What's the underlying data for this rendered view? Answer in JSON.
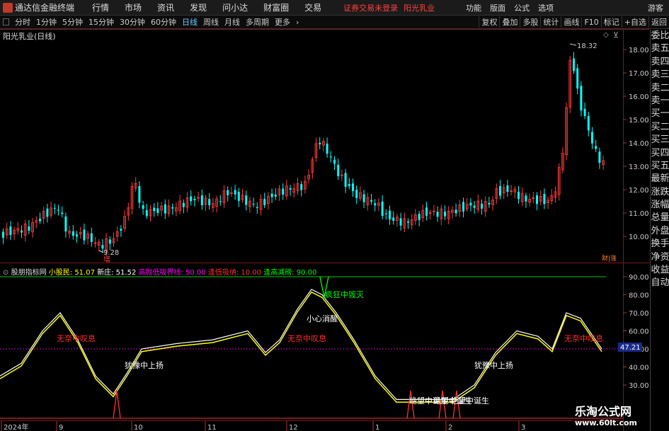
{
  "menubar": {
    "app_title": "通达信金融终端",
    "items": [
      "行情",
      "市场",
      "资讯",
      "发现",
      "问小达",
      "财富圈",
      "交易"
    ],
    "warning": "证券交易未登录",
    "stock": "阳光乳业",
    "right_items": [
      "功能",
      "版面",
      "公式",
      "选项"
    ],
    "guest": "游客"
  },
  "toolbar": {
    "periods": [
      "分时",
      "1分钟",
      "5分钟",
      "15分钟",
      "30分钟",
      "60分钟",
      "日线",
      "周线",
      "月线",
      "多周期",
      "更多"
    ],
    "active_period": "日线",
    "right_buttons": [
      "复权",
      "叠加",
      "多股",
      "统计",
      "画线",
      "F10",
      "标记",
      "+自选",
      "返回"
    ]
  },
  "chart": {
    "title": "阳光乳业(日线)",
    "price_labels": [
      "18.00",
      "17.00",
      "16.00",
      "15.00",
      "14.00",
      "13.00",
      "12.00",
      "11.00",
      "10.00"
    ],
    "high_label": "18.32",
    "low_label": "9.28",
    "low_tag": "增",
    "corner_tag": "财|涨",
    "up_color": "#ff3b3b",
    "down_color": "#00ffff"
  },
  "indicator": {
    "name": "股朋指标网",
    "values": [
      {
        "label": "小股民: 51.07",
        "color": "#ffff00"
      },
      {
        "label": "新庄: 51.52",
        "color": "#ffffff"
      },
      {
        "label": "高抛低吸界线: 50.00",
        "color": "#ff00ff"
      },
      {
        "label": "逢低吸纳: 10.00",
        "color": "#ff3030"
      },
      {
        "label": "逢高减磅: 90.00",
        "color": "#00ff00"
      }
    ],
    "y_labels": [
      "90.00",
      "80.00",
      "70.00",
      "60.00",
      "50.00",
      "40.00",
      "30.00"
    ],
    "current_value": "47.21",
    "annotations": [
      {
        "text": "无奈中叹息",
        "color": "#ff3030"
      },
      {
        "text": "无奈中叹息",
        "color": "#ff3030"
      },
      {
        "text": "无奈中叹息",
        "color": "#ff3030"
      },
      {
        "text": "犹豫中上扬",
        "color": "#ffffff"
      },
      {
        "text": "犹豫中上扬",
        "color": "#ffffff"
      },
      {
        "text": "小心消醒",
        "color": "#ffffff"
      },
      {
        "text": "疯狂中毁灭",
        "color": "#00ff00"
      },
      {
        "text": "绝望中诞生",
        "color": "#ffffff"
      },
      {
        "text": "绝望中诞生",
        "color": "#ffffff"
      },
      {
        "text": "绝望中诞生",
        "color": "#ffffff"
      }
    ]
  },
  "time_axis": [
    "2024年",
    "9",
    "10",
    "11",
    "12",
    "1",
    "2",
    "3"
  ],
  "right_panel": [
    "委比",
    "卖五",
    "卖四",
    "卖三",
    "卖二",
    "卖一",
    "买一",
    "买二",
    "买三",
    "买四",
    "买五",
    "最新",
    "涨跌",
    "涨幅",
    "总量",
    "外盘",
    "换手",
    "净资",
    "收益",
    "自动"
  ],
  "watermark": {
    "line1": "乐淘公式网",
    "line2": "www.60lt.com"
  }
}
